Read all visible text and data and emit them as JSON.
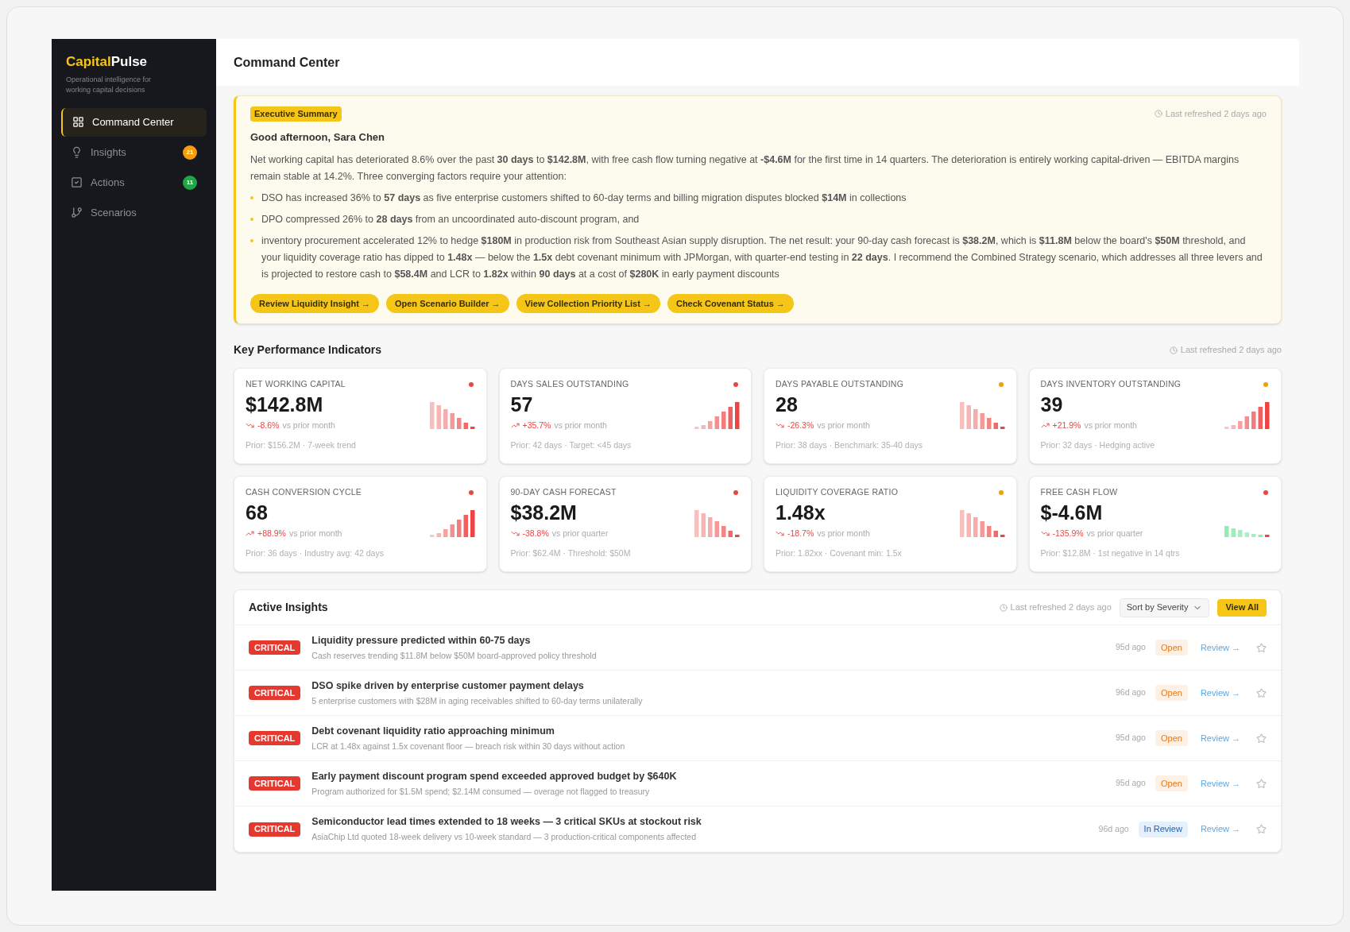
{
  "brand": {
    "part_1": "Capital",
    "part_2": "Pulse",
    "tagline": "Operational intelligence for working capital decisions"
  },
  "nav": [
    {
      "label": "Command Center",
      "selected": true
    },
    {
      "label": "Insights",
      "selected": false,
      "badge": "21",
      "color": "#f59e0b"
    },
    {
      "label": "Actions",
      "selected": false,
      "badge": "11",
      "color": "#22a447"
    },
    {
      "label": "Scenarios",
      "selected": false
    }
  ],
  "header": {
    "title": "Command Center"
  },
  "summary": {
    "tag": "Executive Summary",
    "refreshed": "Last refreshed 2 days ago",
    "greeting": "Good afternoon, Sara Chen",
    "intro": "Net working capital has deteriorated 8.6% over the past **30 days** to **$142.8M**, with free cash flow turning negative at **-$4.6M** for the first time in 14 quarters. The deterioration is entirely working capital-driven — EBITDA margins remain stable at 14.2%. Three converging factors require your attention:",
    "points": [
      "DSO has increased 36% to **57 days** as five enterprise customers shifted to 60-day terms and billing migration disputes blocked **$14M** in collections",
      "DPO compressed 26% to **28 days** from an uncoordinated auto-discount program, and",
      "inventory procurement accelerated 12% to hedge **$180M** in production risk from Southeast Asian supply disruption. The net result: your 90-day cash forecast is **$38.2M**, which is **$11.8M** below the board's **$50M** threshold, and your liquidity coverage ratio has dipped to **1.48x** — below the **1.5x** debt covenant minimum with JPMorgan, with quarter-end testing in **22 days**. I recommend the Combined Strategy scenario, which addresses all three levers and is projected to restore cash to **$58.4M** and LCR to **1.82x** within **90 days** at a cost of **$280K** in early payment discounts"
    ],
    "actions": [
      "Review Liquidity Insight →",
      "Open Scenario Builder →",
      "View Collection Priority List →",
      "Check Covenant Status →"
    ]
  },
  "kpi": {
    "title": "Key Performance Indicators",
    "refreshed": "Last refreshed 2 days ago",
    "cards": [
      {
        "label": "NET WORKING CAPITAL",
        "value": "$142.8M",
        "change": "-8.6%",
        "period": "vs prior month",
        "footer": "Prior: $156.2M · 7-week trend",
        "color": "#ef4444",
        "kind": "falling"
      },
      {
        "label": "DAYS SALES OUTSTANDING",
        "value": "57",
        "change": "+35.7%",
        "period": "vs prior month",
        "footer": "Prior: 42 days · Target: <45 days",
        "color": "#ef4444",
        "kind": "rising"
      },
      {
        "label": "DAYS PAYABLE OUTSTANDING",
        "value": "28",
        "change": "-26.3%",
        "period": "vs prior month",
        "footer": "Prior: 38 days · Benchmark: 35-40 days",
        "color": "#f59e0b",
        "kind": "falling"
      },
      {
        "label": "DAYS INVENTORY OUTSTANDING",
        "value": "39",
        "change": "+21.9%",
        "period": "vs prior month",
        "footer": "Prior: 32 days · Hedging active",
        "color": "#f59e0b",
        "kind": "rising"
      },
      {
        "label": "CASH CONVERSION CYCLE",
        "value": "68",
        "change": "+88.9%",
        "period": "vs prior month",
        "footer": "Prior: 36 days · Industry avg: 42 days",
        "color": "#ef4444",
        "kind": "rising"
      },
      {
        "label": "90-DAY CASH FORECAST",
        "value": "$38.2M",
        "change": "-38.8%",
        "period": "vs prior quarter",
        "footer": "Prior: $62.4M · Threshold: $50M",
        "color": "#ef4444",
        "kind": "falling"
      },
      {
        "label": "LIQUIDITY COVERAGE RATIO",
        "value": "1.48x",
        "change": "-18.7%",
        "period": "vs prior month",
        "footer": "Prior: 1.82xx · Covenant min: 1.5x",
        "color": "#f59e0b",
        "kind": "falling"
      },
      {
        "label": "FREE CASH FLOW",
        "value": "$-4.6M",
        "change": "-135.9%",
        "period": "vs prior quarter",
        "footer": "Prior: $12.8M · 1st negative in 14 qtrs",
        "color": "#ef4444",
        "kind": "negative"
      }
    ]
  },
  "insights": {
    "title": "Active Insights",
    "refreshed": "Last refreshed 2 days ago",
    "sort": "Sort by Severity",
    "view_all": "View All",
    "rows": [
      {
        "severity": "CRITICAL",
        "title": "Liquidity pressure predicted within 60-75 days",
        "detail": "Cash reserves trending $11.8M below $50M board-approved policy threshold",
        "age": "95d ago",
        "status": "Open",
        "kind": "open",
        "action": "Review →"
      },
      {
        "severity": "CRITICAL",
        "title": "DSO spike driven by enterprise customer payment delays",
        "detail": "5 enterprise customers with $28M in aging receivables shifted to 60-day terms unilaterally",
        "age": "96d ago",
        "status": "Open",
        "kind": "open",
        "action": "Review →"
      },
      {
        "severity": "CRITICAL",
        "title": "Debt covenant liquidity ratio approaching minimum",
        "detail": "LCR at 1.48x against 1.5x covenant floor — breach risk within 30 days without action",
        "age": "95d ago",
        "status": "Open",
        "kind": "open",
        "action": "Review →"
      },
      {
        "severity": "CRITICAL",
        "title": "Early payment discount program spend exceeded approved budget by $640K",
        "detail": "Program authorized for $1.5M spend; $2.14M consumed — overage not flagged to treasury",
        "age": "95d ago",
        "status": "Open",
        "kind": "open",
        "action": "Review →"
      },
      {
        "severity": "CRITICAL",
        "title": "Semiconductor lead times extended to 18 weeks — 3 critical SKUs at stockout risk",
        "detail": "AsiaChip Ltd quoted 18-week delivery vs 10-week standard — 3 production-critical components affected",
        "age": "96d ago",
        "status": "In Review",
        "kind": "review",
        "action": "Review →"
      }
    ]
  }
}
